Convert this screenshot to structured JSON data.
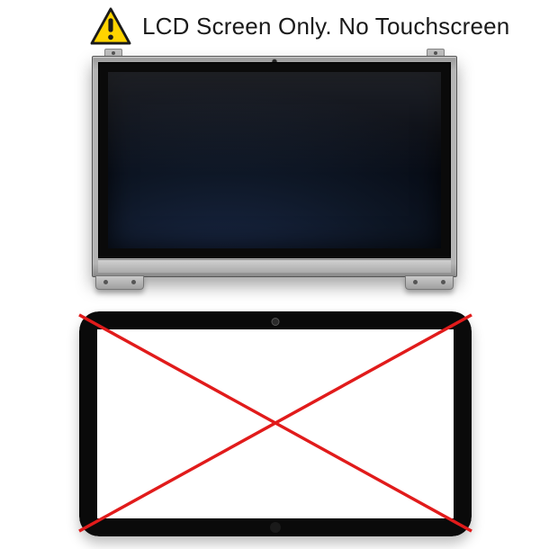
{
  "header": {
    "warning_icon": "warning-triangle",
    "title": "LCD Screen Only. No Touchscreen"
  },
  "illustrations": {
    "lcd": {
      "label": "lcd-panel"
    },
    "touch": {
      "label": "touchscreen-digitizer",
      "crossed_out": true
    }
  },
  "colors": {
    "warning_yellow": "#ffd400",
    "warning_border": "#1a1a1a",
    "cross_red": "#e11b1b"
  }
}
